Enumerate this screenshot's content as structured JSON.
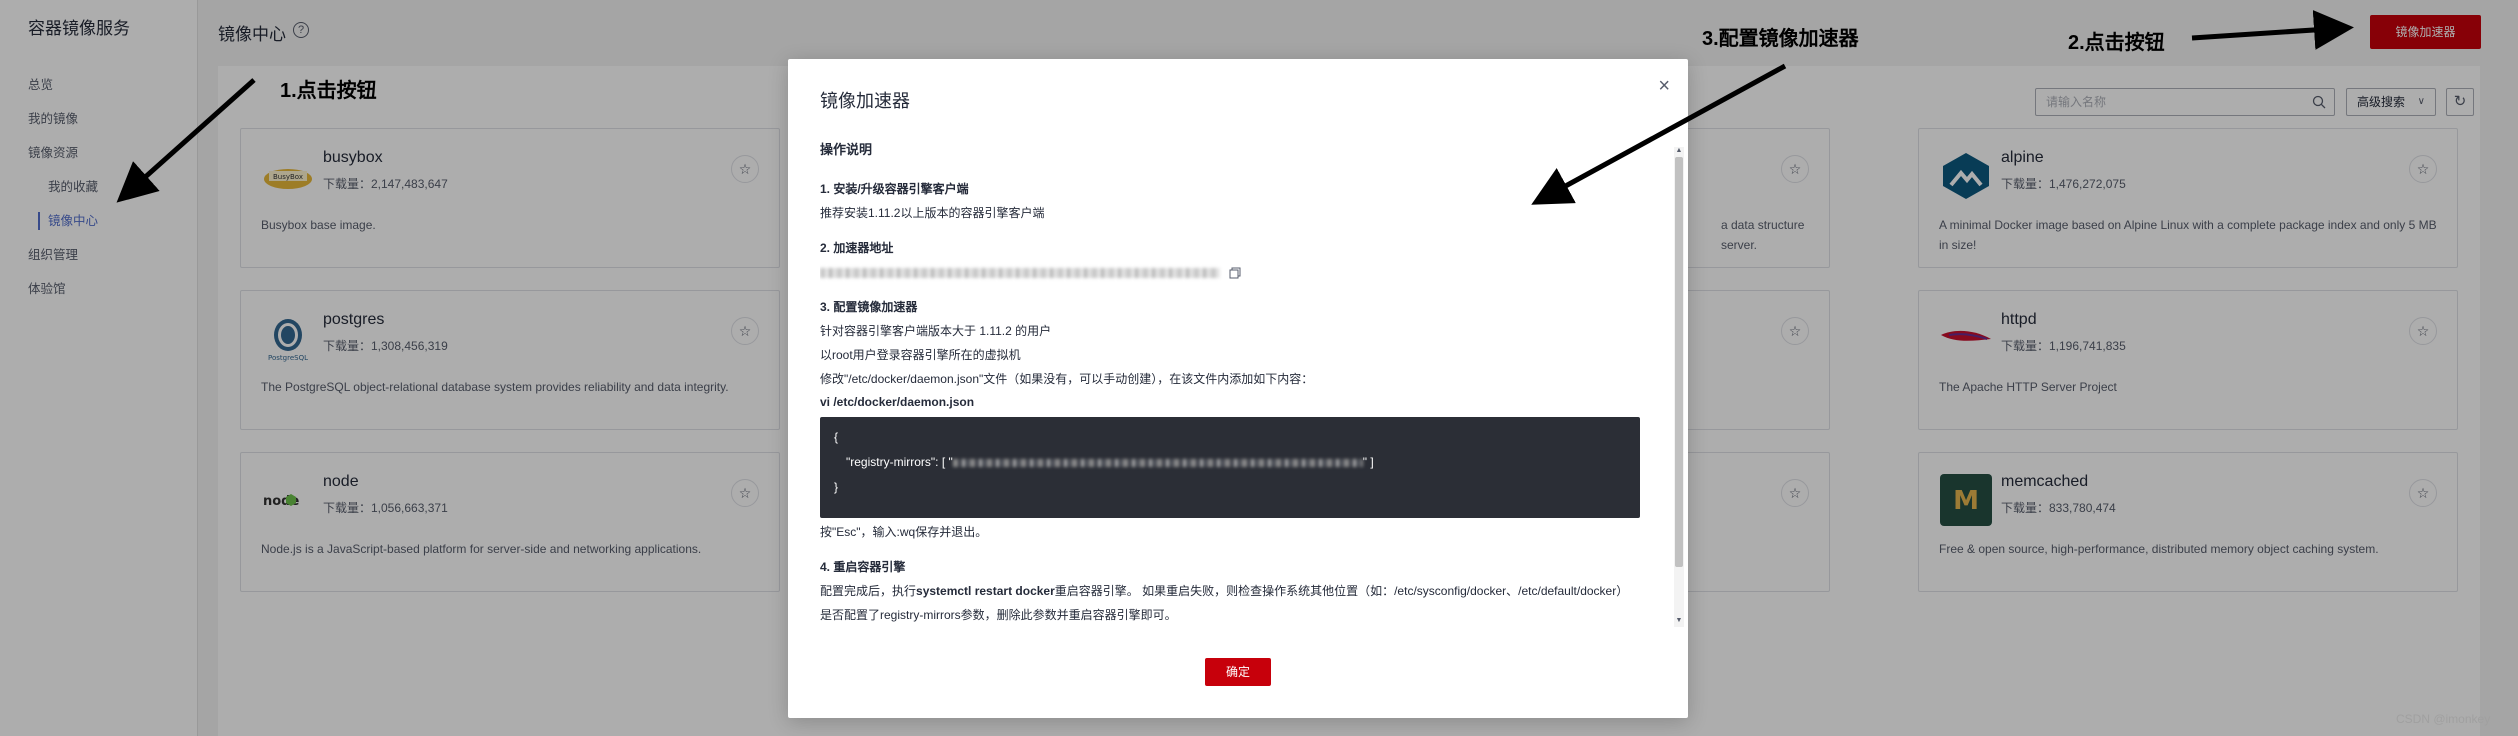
{
  "sidebar": {
    "title": "容器镜像服务",
    "items": [
      {
        "label": "总览"
      },
      {
        "label": "我的镜像"
      },
      {
        "label": "镜像资源"
      },
      {
        "label": "组织管理"
      },
      {
        "label": "体验馆"
      }
    ],
    "sub_items": [
      {
        "label": "我的收藏"
      },
      {
        "label": "镜像中心"
      }
    ]
  },
  "header": {
    "title": "镜像中心",
    "help_icon": "question-circle-icon",
    "accelerator_button": "镜像加速器"
  },
  "toolbar": {
    "search_placeholder": "请输入名称",
    "advanced_search": "高级搜索"
  },
  "images": [
    {
      "name": "busybox",
      "downloads": "下载量：2,147,483,647",
      "description": "Busybox base image."
    },
    {
      "name": "postgres",
      "downloads": "下载量：1,308,456,319",
      "description": "The PostgreSQL object-relational database system provides reliability and data integrity."
    },
    {
      "name": "node",
      "downloads": "下载量：1,056,663,371",
      "description": "Node.js is a JavaScript-based platform for server-side and networking applications."
    },
    {
      "name": "alpine",
      "downloads": "下载量：1,476,272,075",
      "description": "A minimal Docker image based on Alpine Linux with a complete package index and only 5 MB in size!"
    },
    {
      "name": "httpd",
      "downloads": "下载量：1,196,741,835",
      "description": "The Apache HTTP Server Project"
    },
    {
      "name": "memcached",
      "downloads": "下载量：833,780,474",
      "description": "Free & open source, high-performance, distributed memory object caching system."
    },
    {
      "description_partial": "a data structure server."
    }
  ],
  "modal": {
    "title": "镜像加速器",
    "section_title": "操作说明",
    "step1_title": "1. 安装/升级容器引擎客户端",
    "step1_text": "推荐安装1.11.2以上版本的容器引擎客户端",
    "step2_title": "2. 加速器地址",
    "step3_title": "3. 配置镜像加速器",
    "step3_line1": "针对容器引擎客户端版本大于 1.11.2 的用户",
    "step3_line2": "以root用户登录容器引擎所在的虚拟机",
    "step3_line3": "修改\"/etc/docker/daemon.json\"文件（如果没有，可以手动创建），在该文件内添加如下内容：",
    "step3_file": "vi /etc/docker/daemon.json",
    "code_open": "{",
    "code_key": "\"registry-mirrors\": [ \"",
    "code_end": "\" ]",
    "code_close": "}",
    "step3_after": "按\"Esc\"，输入:wq保存并退出。",
    "step4_title": "4. 重启容器引擎",
    "step4_line1_a": "配置完成后，执行",
    "step4_line1_b": "systemctl restart docker",
    "step4_line1_c": "重启容器引擎。 如果重启失败，则检查操作系统其他位置（如：/etc/sysconfig/docker、/etc/default/docker）",
    "step4_line2": "是否配置了registry-mirrors参数，删除此参数并重启容器引擎即可。",
    "ok_button": "确定",
    "close_icon": "close-icon"
  },
  "annotations": {
    "a1": "1.点击按钮",
    "a2": "2.点击按钮",
    "a3": "3.配置镜像加速器"
  },
  "watermark": "CSDN @imonkey",
  "colors": {
    "accent_red": "#c7000b",
    "active_blue": "#526ecc",
    "code_bg": "#2b2e36"
  }
}
